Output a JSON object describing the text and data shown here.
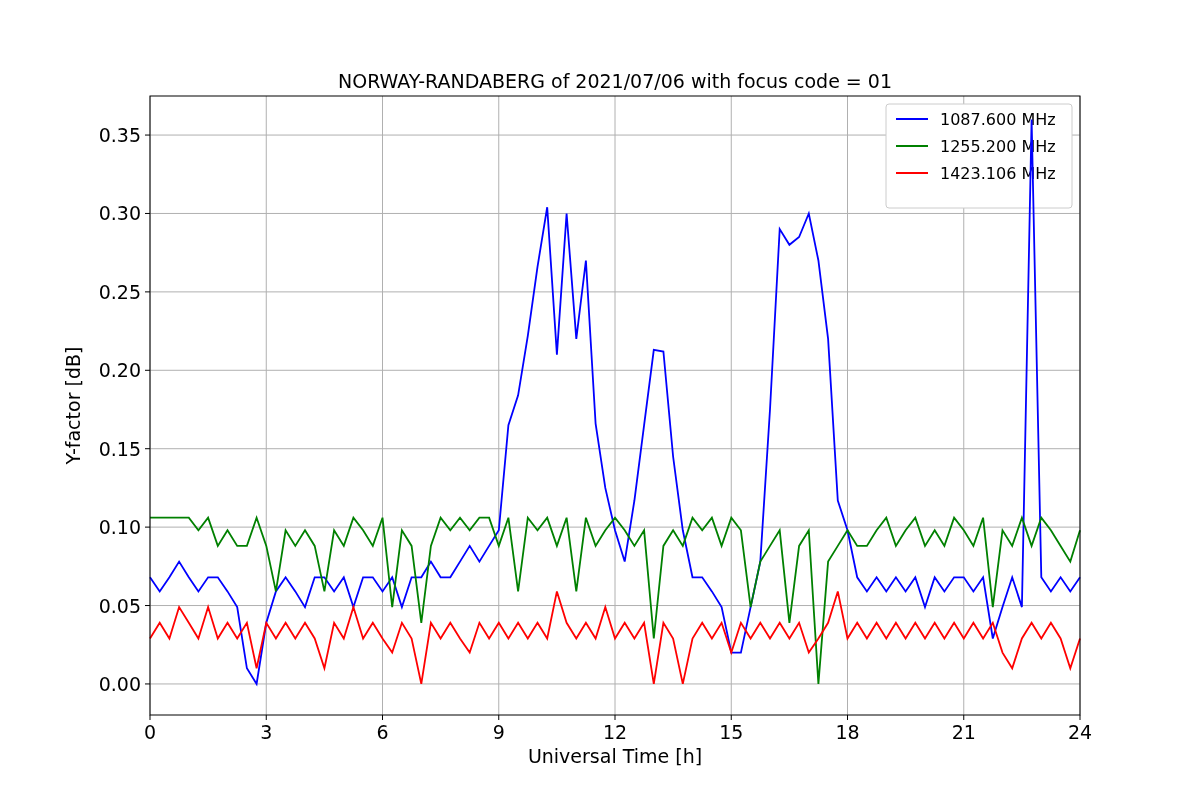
{
  "figure": {
    "chart_data": {
      "type": "line",
      "title": "NORWAY-RANDABERG of 2021/07/06 with focus code = 01",
      "xlabel": "Universal Time [h]",
      "ylabel": "Y-factor [dB]",
      "x": [
        0,
        0.25,
        0.5,
        0.75,
        1,
        1.25,
        1.5,
        1.75,
        2,
        2.25,
        2.5,
        2.75,
        3,
        3.25,
        3.5,
        3.75,
        4,
        4.25,
        4.5,
        4.75,
        5,
        5.25,
        5.5,
        5.75,
        6,
        6.25,
        6.5,
        6.75,
        7,
        7.25,
        7.5,
        7.75,
        8,
        8.25,
        8.5,
        8.75,
        9,
        9.25,
        9.5,
        9.75,
        10,
        10.25,
        10.5,
        10.75,
        11,
        11.25,
        11.5,
        11.75,
        12,
        12.25,
        12.5,
        12.75,
        13,
        13.25,
        13.5,
        13.75,
        14,
        14.25,
        14.5,
        14.75,
        15,
        15.25,
        15.5,
        15.75,
        16,
        16.25,
        16.5,
        16.75,
        17,
        17.25,
        17.5,
        17.75,
        18,
        18.25,
        18.5,
        18.75,
        19,
        19.25,
        19.5,
        19.75,
        20,
        20.25,
        20.5,
        20.75,
        21,
        21.25,
        21.5,
        21.75,
        22,
        22.25,
        22.5,
        22.75,
        23,
        23.25,
        23.5,
        23.75,
        24
      ],
      "series": [
        {
          "name": "1087.600 MHz",
          "color": "#0000ff",
          "values": [
            0.068,
            0.059,
            0.068,
            0.078,
            0.068,
            0.059,
            0.068,
            0.068,
            0.059,
            0.049,
            0.01,
            0.0,
            0.039,
            0.059,
            0.068,
            0.059,
            0.049,
            0.068,
            0.068,
            0.059,
            0.068,
            0.049,
            0.068,
            0.068,
            0.059,
            0.068,
            0.049,
            0.068,
            0.068,
            0.078,
            0.068,
            0.068,
            0.078,
            0.088,
            0.078,
            0.088,
            0.098,
            0.165,
            0.184,
            0.222,
            0.266,
            0.304,
            0.21,
            0.3,
            0.22,
            0.27,
            0.166,
            0.125,
            0.098,
            0.078,
            0.117,
            0.165,
            0.213,
            0.212,
            0.145,
            0.098,
            0.068,
            0.068,
            0.059,
            0.049,
            0.02,
            0.02,
            0.049,
            0.078,
            0.175,
            0.29,
            0.28,
            0.285,
            0.3,
            0.27,
            0.22,
            0.117,
            0.098,
            0.068,
            0.059,
            0.068,
            0.059,
            0.068,
            0.059,
            0.068,
            0.049,
            0.068,
            0.059,
            0.068,
            0.068,
            0.059,
            0.068,
            0.029,
            0.049,
            0.068,
            0.049,
            0.36,
            0.068,
            0.059,
            0.068,
            0.059,
            0.068
          ]
        },
        {
          "name": "1255.200 MHz",
          "color": "#008000",
          "values": [
            0.106,
            0.106,
            0.106,
            0.106,
            0.106,
            0.098,
            0.106,
            0.088,
            0.098,
            0.088,
            0.088,
            0.106,
            0.088,
            0.059,
            0.098,
            0.088,
            0.098,
            0.088,
            0.059,
            0.098,
            0.088,
            0.106,
            0.098,
            0.088,
            0.106,
            0.049,
            0.098,
            0.088,
            0.039,
            0.088,
            0.106,
            0.098,
            0.106,
            0.098,
            0.106,
            0.106,
            0.088,
            0.106,
            0.059,
            0.106,
            0.098,
            0.106,
            0.088,
            0.106,
            0.059,
            0.106,
            0.088,
            0.098,
            0.106,
            0.098,
            0.088,
            0.098,
            0.029,
            0.088,
            0.098,
            0.088,
            0.106,
            0.098,
            0.106,
            0.088,
            0.106,
            0.098,
            0.049,
            0.078,
            0.088,
            0.098,
            0.039,
            0.088,
            0.098,
            0.0,
            0.078,
            0.088,
            0.098,
            0.088,
            0.088,
            0.098,
            0.106,
            0.088,
            0.098,
            0.106,
            0.088,
            0.098,
            0.088,
            0.106,
            0.098,
            0.088,
            0.106,
            0.049,
            0.098,
            0.088,
            0.106,
            0.088,
            0.106,
            0.098,
            0.088,
            0.078,
            0.098
          ]
        },
        {
          "name": "1423.106 MHz",
          "color": "#ff0000",
          "values": [
            0.029,
            0.039,
            0.029,
            0.049,
            0.039,
            0.029,
            0.049,
            0.029,
            0.039,
            0.029,
            0.039,
            0.01,
            0.039,
            0.029,
            0.039,
            0.029,
            0.039,
            0.029,
            0.01,
            0.039,
            0.029,
            0.049,
            0.029,
            0.039,
            0.029,
            0.02,
            0.039,
            0.029,
            0.0,
            0.039,
            0.029,
            0.039,
            0.029,
            0.02,
            0.039,
            0.029,
            0.039,
            0.029,
            0.039,
            0.029,
            0.039,
            0.029,
            0.059,
            0.039,
            0.029,
            0.039,
            0.029,
            0.049,
            0.029,
            0.039,
            0.029,
            0.039,
            0.0,
            0.039,
            0.029,
            0.0,
            0.029,
            0.039,
            0.029,
            0.039,
            0.02,
            0.039,
            0.029,
            0.039,
            0.029,
            0.039,
            0.029,
            0.039,
            0.02,
            0.029,
            0.039,
            0.059,
            0.029,
            0.039,
            0.029,
            0.039,
            0.029,
            0.039,
            0.029,
            0.039,
            0.029,
            0.039,
            0.029,
            0.039,
            0.029,
            0.039,
            0.029,
            0.039,
            0.02,
            0.01,
            0.029,
            0.039,
            0.029,
            0.039,
            0.029,
            0.01,
            0.029
          ]
        }
      ],
      "grid": true,
      "legend": true,
      "xlim": [
        0,
        24
      ],
      "ylim": [
        -0.0198,
        0.3749
      ],
      "xticks": [
        0,
        3,
        6,
        9,
        12,
        15,
        18,
        21,
        24
      ],
      "yticks": [
        {
          "value": 0,
          "label": "0.00"
        },
        {
          "value": 0.05,
          "label": "0.05"
        },
        {
          "value": 0.1,
          "label": "0.10"
        },
        {
          "value": 0.15,
          "label": "0.15"
        },
        {
          "value": 0.2,
          "label": "0.20"
        },
        {
          "value": 0.25,
          "label": "0.25"
        },
        {
          "value": 0.3,
          "label": "0.30"
        },
        {
          "value": 0.35,
          "label": "0.35"
        }
      ]
    }
  }
}
